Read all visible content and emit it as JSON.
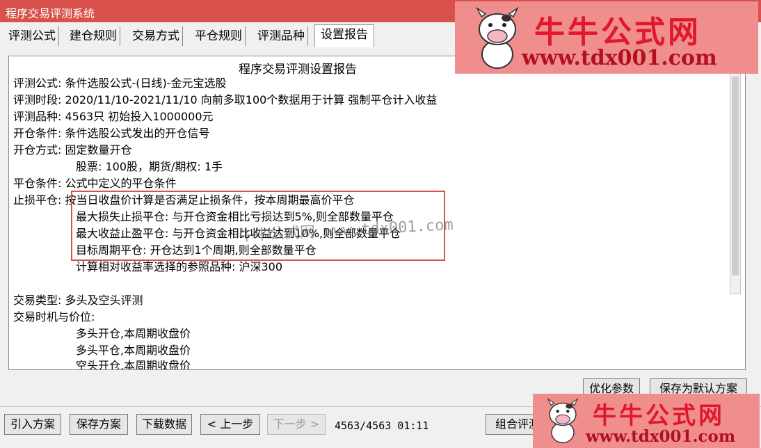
{
  "window": {
    "title": "程序交易评测系统"
  },
  "tabs": [
    "评测公式",
    "建仓规则",
    "交易方式",
    "平仓规则",
    "评测品种",
    "设置报告"
  ],
  "report": {
    "title": "程序交易评测设置报告",
    "lines": [
      "评测公式: 条件选股公式-(日线)-金元宝选股",
      "评测时段: 2020/11/10-2021/11/10 向前多取100个数据用于计算 强制平仓计入收益",
      "评测品种: 4563只 初始投入1000000元",
      "开仓条件: 条件选股公式发出的开仓信号",
      "开仓方式: 固定数量开仓",
      "股票: 100股，期货/期权: 1手",
      "平仓条件: 公式中定义的平仓条件",
      "止损平仓: 按当日收盘价计算是否满足止损条件，按本周期最高价平仓",
      "最大损失止损平仓: 与开仓资金相比亏损达到5%,则全部数量平仓",
      "最大收益止盈平仓: 与开仓资金相比收益达到10%,则全部数量平仓",
      "目标周期平仓: 开仓达到1个周期,则全部数量平仓",
      "计算相对收益率选择的参照品种: 沪深300",
      "交易类型: 多头及空头评测",
      "交易时机与价位:",
      "多头开仓,本周期收盘价",
      "多头平仓,本周期收盘价",
      "空头开仓,本周期收盘价"
    ]
  },
  "watermark": "牛牛公式网 www.tdx001.com",
  "panel_buttons": {
    "optimize": "优化参数",
    "save_default": "保存为默认方案"
  },
  "footer": {
    "import": "引入方案",
    "save": "保存方案",
    "download": "下载数据",
    "prev": "< 上一步",
    "next": "下一步 >",
    "status": "4563/4563 01:11",
    "combo": "组合评测"
  },
  "logo": {
    "brand": "牛牛公式网",
    "url": "www.tdx001.com"
  },
  "colors": {
    "titlebar": "#d9514c",
    "highlight": "#d9514c",
    "logo_bg": "#f08e8e",
    "logo_text": "#e0182c"
  }
}
